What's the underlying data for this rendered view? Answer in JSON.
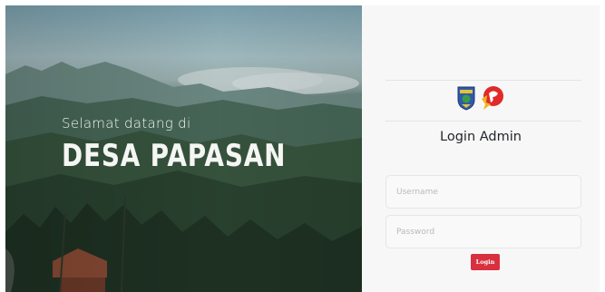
{
  "hero": {
    "welcome_text": "Selamat datang di",
    "village_name": "DESA PAPASAN"
  },
  "login_panel": {
    "logo_left_icon": "regency-crest-icon",
    "logo_right_icon": "red-lion-emblem-icon",
    "title": "Login Admin",
    "username_placeholder": "Username",
    "password_placeholder": "Password",
    "login_button_label": "Login"
  },
  "colors": {
    "accent": "#d8303f",
    "panel_background": "#f7f7f8",
    "title_text": "#23262a"
  }
}
